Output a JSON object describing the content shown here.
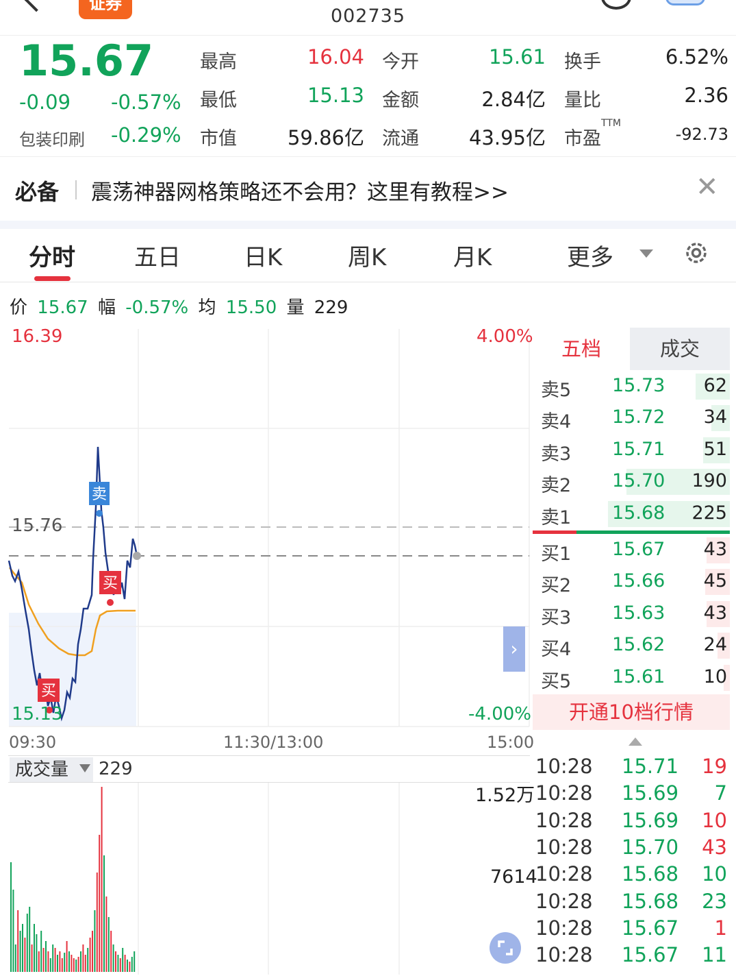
{
  "header": {
    "brand_label": "证券",
    "stock_code": "002735"
  },
  "quote": {
    "price": "15.67",
    "change": "-0.09",
    "change_pct": "-0.57%",
    "industry": "包装印刷",
    "industry_pct": "-0.29%",
    "fields": [
      {
        "label": "最高",
        "value": "16.04",
        "color": "red"
      },
      {
        "label": "今开",
        "value": "15.61",
        "color": "green"
      },
      {
        "label": "换手",
        "value": "6.52%",
        "color": "dark"
      },
      {
        "label": "最低",
        "value": "15.13",
        "color": "green"
      },
      {
        "label": "金额",
        "value": "2.84亿",
        "color": "dark"
      },
      {
        "label": "量比",
        "value": "2.36",
        "color": "dark"
      },
      {
        "label": "市值",
        "value": "59.86亿",
        "color": "dark"
      },
      {
        "label": "流通",
        "value": "43.95亿",
        "color": "dark"
      },
      {
        "label": "市盈",
        "value": "-92.73",
        "color": "dark",
        "sup": "TTM"
      }
    ]
  },
  "notice": {
    "tag": "必备",
    "text": "震荡神器网格策略还不会用？这里有教程>>"
  },
  "tabs": [
    "分时",
    "五日",
    "日K",
    "周K",
    "月K",
    "更多"
  ],
  "infoline": {
    "price_label": "价",
    "price": "15.67",
    "amp_label": "幅",
    "amp": "-0.57%",
    "avg_label": "均",
    "avg": "15.50",
    "vol_label": "量",
    "vol": "229"
  },
  "chart": {
    "top_price": "16.39",
    "bottom_price": "15.13",
    "top_pct": "4.00%",
    "bottom_pct": "-4.00%",
    "ref_price": "15.76",
    "time_start": "09:30",
    "time_mid": "11:30/13:00",
    "time_end": "15:00",
    "marker_sell": "卖",
    "marker_buy": "买",
    "colors": {
      "price_line": "#1f3a8a",
      "avg_line": "#f0a020",
      "up": "#e5323e",
      "down": "#11a35a"
    }
  },
  "orderbook": {
    "tab_five": "五档",
    "tab_trades": "成交",
    "asks": [
      {
        "label": "卖5",
        "price": "15.73",
        "vol": "62",
        "bar": 0.28
      },
      {
        "label": "卖4",
        "price": "15.72",
        "vol": "34",
        "bar": 0.15
      },
      {
        "label": "卖3",
        "price": "15.71",
        "vol": "51",
        "bar": 0.22
      },
      {
        "label": "卖2",
        "price": "15.70",
        "vol": "190",
        "bar": 0.85
      },
      {
        "label": "卖1",
        "price": "15.68",
        "vol": "225",
        "bar": 1.0
      }
    ],
    "bids": [
      {
        "label": "买1",
        "price": "15.67",
        "vol": "43",
        "bar": 0.19
      },
      {
        "label": "买2",
        "price": "15.66",
        "vol": "45",
        "bar": 0.2
      },
      {
        "label": "买3",
        "price": "15.63",
        "vol": "43",
        "bar": 0.19
      },
      {
        "label": "买4",
        "price": "15.62",
        "vol": "24",
        "bar": 0.1
      },
      {
        "label": "买5",
        "price": "15.61",
        "vol": "10",
        "bar": 0.05
      }
    ],
    "upgrade_label": "开通10档行情"
  },
  "volume": {
    "selector_label": "成交量",
    "current": "229",
    "max_label": "1.52万",
    "mid_label": "7614"
  },
  "trades": [
    {
      "time": "10:28",
      "price": "15.71",
      "vol": "19",
      "dir": "up"
    },
    {
      "time": "10:28",
      "price": "15.69",
      "vol": "7",
      "dir": "down"
    },
    {
      "time": "10:28",
      "price": "15.69",
      "vol": "10",
      "dir": "up"
    },
    {
      "time": "10:28",
      "price": "15.70",
      "vol": "43",
      "dir": "up"
    },
    {
      "time": "10:28",
      "price": "15.68",
      "vol": "10",
      "dir": "down"
    },
    {
      "time": "10:28",
      "price": "15.68",
      "vol": "23",
      "dir": "down"
    },
    {
      "time": "10:28",
      "price": "15.67",
      "vol": "1",
      "dir": "up"
    },
    {
      "time": "10:28",
      "price": "15.67",
      "vol": "11",
      "dir": "down"
    }
  ]
}
